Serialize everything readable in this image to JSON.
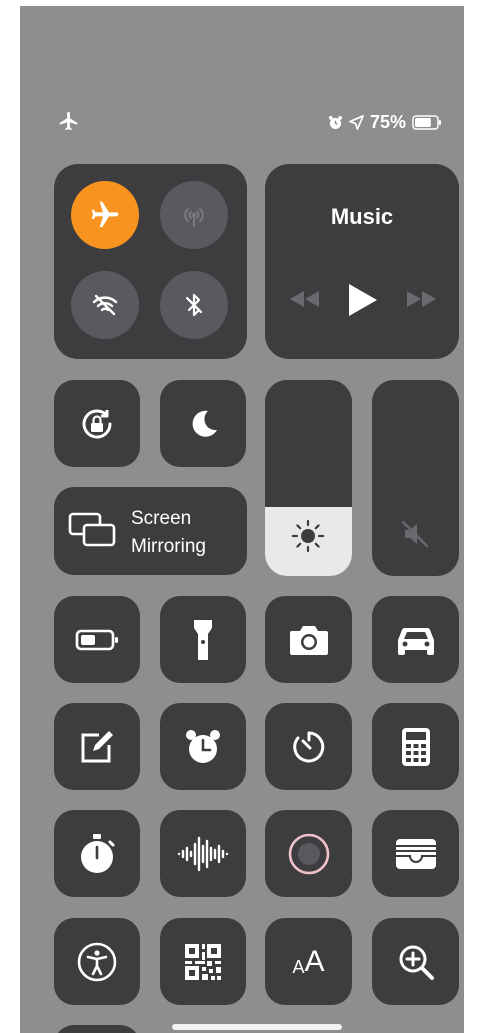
{
  "status_bar": {
    "left_icon": "airplane-icon",
    "right_icons": [
      "alarm-icon",
      "location-arrow-icon"
    ],
    "battery_percent": "75%",
    "battery_level": 0.75
  },
  "connectivity": {
    "airplane": {
      "icon": "airplane-icon",
      "on": true,
      "color": "#f7931e"
    },
    "cellular": {
      "icon": "cellular-antenna-icon",
      "on": false
    },
    "wifi": {
      "icon": "wifi-off-icon",
      "on": false
    },
    "bluetooth": {
      "icon": "bluetooth-off-icon",
      "on": false
    }
  },
  "music": {
    "title": "Music",
    "controls": [
      "rewind-icon",
      "play-icon",
      "fast-forward-icon"
    ]
  },
  "screen_mirroring": {
    "line1": "Screen",
    "line2": "Mirroring"
  },
  "sliders": {
    "brightness": {
      "icon": "sun-icon",
      "level": 0.35
    },
    "volume": {
      "icon": "speaker-muted-icon",
      "level": 0.0
    }
  },
  "toggles_row1": [
    "rotation-lock-icon",
    "moon-icon"
  ],
  "grid_icons": [
    [
      "battery-icon",
      "flashlight-icon",
      "camera-icon",
      "car-icon"
    ],
    [
      "notes-icon",
      "alarm-clock-icon",
      "timer-icon",
      "calculator-icon"
    ],
    [
      "stopwatch-icon",
      "voice-memo-icon",
      "screen-record-icon",
      "wallet-icon"
    ],
    [
      "accessibility-icon",
      "qr-code-icon",
      "text-size-icon",
      "magnifier-icon"
    ]
  ],
  "text_size": {
    "small": "A",
    "large": "A"
  },
  "colors": {
    "accent": "#f7931e",
    "tile": "#3d3d40",
    "background": "#8e8e90"
  }
}
